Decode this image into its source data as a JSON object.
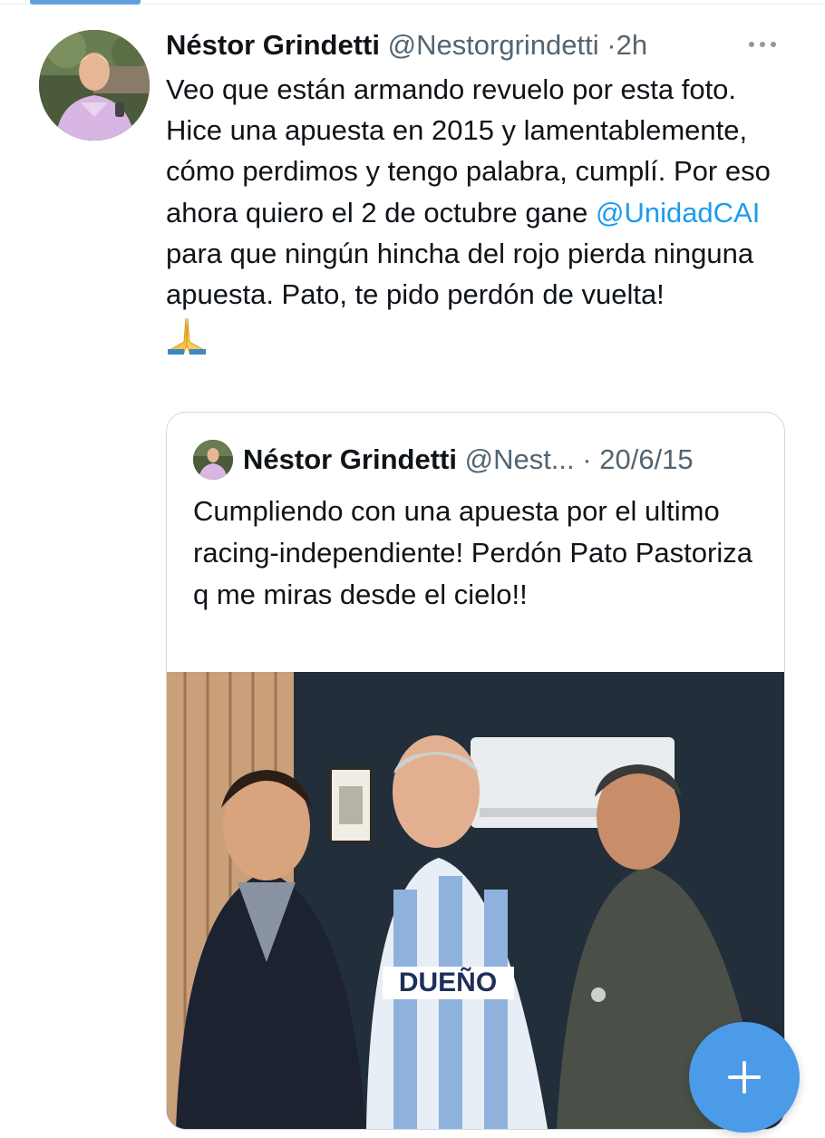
{
  "tweet": {
    "author": {
      "name": "Néstor Grindetti",
      "handle": "@Nestorgrindetti",
      "avatar_icon": "profile-photo"
    },
    "separator": "·",
    "time": "2h",
    "more_icon": "more-horizontal-icon",
    "text_parts": {
      "before_mention": "Veo que están armando revuelo por esta foto. Hice una apuesta en 2015 y lamentablemente, cómo perdimos y tengo palabra, cumplí. Por eso ahora quiero el 2 de octubre gane ",
      "mention": "@UnidadCAI",
      "after_mention": " para que ningún hincha del rojo pierda ninguna apuesta. Pato, te pido perdón de vuelta!",
      "emoji": "🙏"
    }
  },
  "quoted_tweet": {
    "author": {
      "name": "Néstor Grindetti",
      "handle": "@Nest...",
      "avatar_icon": "profile-photo"
    },
    "separator": "·",
    "date": "20/6/15",
    "text": "Cumpliendo con una apuesta por el ultimo racing-independiente! Perdón Pato Pastoriza q me miras desde el cielo!!",
    "photo": {
      "shirt_text": "DUEÑO"
    }
  },
  "compose_button": {
    "icon": "plus-icon"
  },
  "colors": {
    "accent": "#1d9bf0",
    "fab": "#4c9be8",
    "secondary_text": "#536471"
  }
}
